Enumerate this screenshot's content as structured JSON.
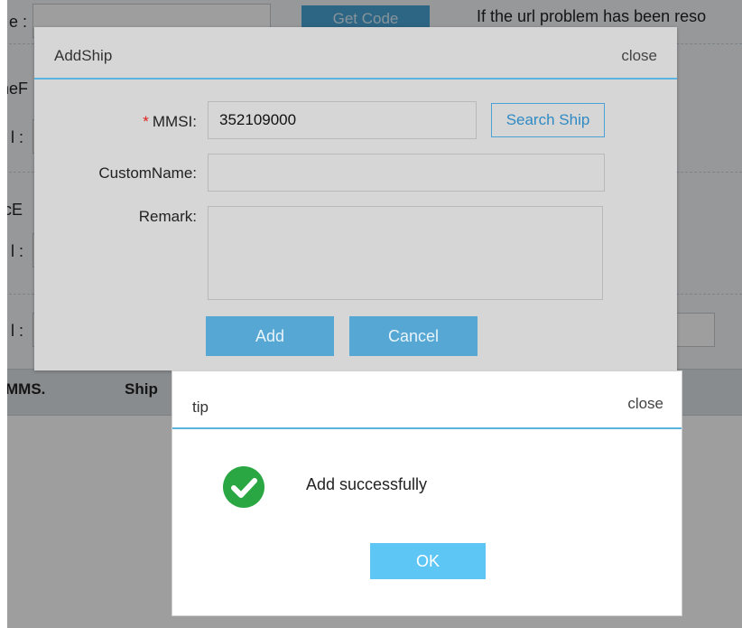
{
  "background": {
    "labels": [
      "e :",
      "neF",
      "l :",
      "icE",
      "l :",
      "l :"
    ],
    "get_code_label": "Get Code",
    "url_note": "If the url problem has been reso",
    "table_headers": [
      "MMS.",
      "Ship"
    ]
  },
  "add_ship_dialog": {
    "title": "AddShip",
    "close_label": "close",
    "mmsi_required_mark": "*",
    "mmsi_label": "MMSI:",
    "mmsi_value": "352109000",
    "search_ship_label": "Search Ship",
    "custom_name_label": "CustomName:",
    "custom_name_value": "",
    "remark_label": "Remark:",
    "remark_value": "",
    "add_label": "Add",
    "cancel_label": "Cancel"
  },
  "tip_dialog": {
    "title": "tip",
    "close_label": "close",
    "icon": "success-check-icon",
    "message": "Add successfully",
    "ok_label": "OK"
  },
  "colors": {
    "accent_blue": "#5ab3e0",
    "success_green": "#2aa743",
    "required_red": "#e02020"
  }
}
